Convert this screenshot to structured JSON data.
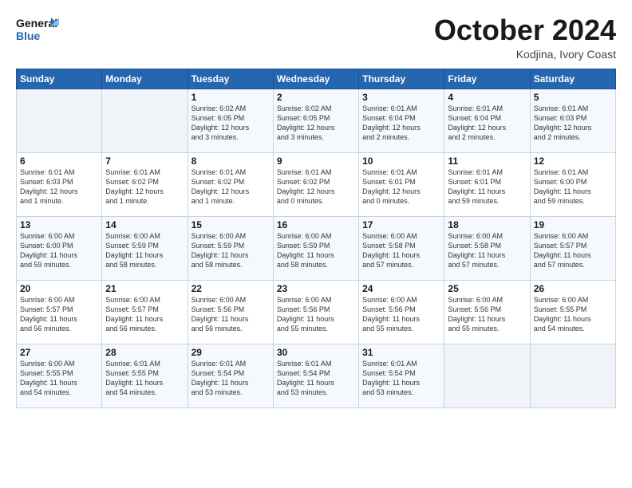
{
  "header": {
    "logo_line1": "General",
    "logo_line2": "Blue",
    "month_title": "October 2024",
    "subtitle": "Kodjina, Ivory Coast"
  },
  "weekdays": [
    "Sunday",
    "Monday",
    "Tuesday",
    "Wednesday",
    "Thursday",
    "Friday",
    "Saturday"
  ],
  "weeks": [
    [
      {
        "day": "",
        "info": ""
      },
      {
        "day": "",
        "info": ""
      },
      {
        "day": "1",
        "info": "Sunrise: 6:02 AM\nSunset: 6:05 PM\nDaylight: 12 hours\nand 3 minutes."
      },
      {
        "day": "2",
        "info": "Sunrise: 6:02 AM\nSunset: 6:05 PM\nDaylight: 12 hours\nand 3 minutes."
      },
      {
        "day": "3",
        "info": "Sunrise: 6:01 AM\nSunset: 6:04 PM\nDaylight: 12 hours\nand 2 minutes."
      },
      {
        "day": "4",
        "info": "Sunrise: 6:01 AM\nSunset: 6:04 PM\nDaylight: 12 hours\nand 2 minutes."
      },
      {
        "day": "5",
        "info": "Sunrise: 6:01 AM\nSunset: 6:03 PM\nDaylight: 12 hours\nand 2 minutes."
      }
    ],
    [
      {
        "day": "6",
        "info": "Sunrise: 6:01 AM\nSunset: 6:03 PM\nDaylight: 12 hours\nand 1 minute."
      },
      {
        "day": "7",
        "info": "Sunrise: 6:01 AM\nSunset: 6:02 PM\nDaylight: 12 hours\nand 1 minute."
      },
      {
        "day": "8",
        "info": "Sunrise: 6:01 AM\nSunset: 6:02 PM\nDaylight: 12 hours\nand 1 minute."
      },
      {
        "day": "9",
        "info": "Sunrise: 6:01 AM\nSunset: 6:02 PM\nDaylight: 12 hours\nand 0 minutes."
      },
      {
        "day": "10",
        "info": "Sunrise: 6:01 AM\nSunset: 6:01 PM\nDaylight: 12 hours\nand 0 minutes."
      },
      {
        "day": "11",
        "info": "Sunrise: 6:01 AM\nSunset: 6:01 PM\nDaylight: 11 hours\nand 59 minutes."
      },
      {
        "day": "12",
        "info": "Sunrise: 6:01 AM\nSunset: 6:00 PM\nDaylight: 11 hours\nand 59 minutes."
      }
    ],
    [
      {
        "day": "13",
        "info": "Sunrise: 6:00 AM\nSunset: 6:00 PM\nDaylight: 11 hours\nand 59 minutes."
      },
      {
        "day": "14",
        "info": "Sunrise: 6:00 AM\nSunset: 5:59 PM\nDaylight: 11 hours\nand 58 minutes."
      },
      {
        "day": "15",
        "info": "Sunrise: 6:00 AM\nSunset: 5:59 PM\nDaylight: 11 hours\nand 58 minutes."
      },
      {
        "day": "16",
        "info": "Sunrise: 6:00 AM\nSunset: 5:59 PM\nDaylight: 11 hours\nand 58 minutes."
      },
      {
        "day": "17",
        "info": "Sunrise: 6:00 AM\nSunset: 5:58 PM\nDaylight: 11 hours\nand 57 minutes."
      },
      {
        "day": "18",
        "info": "Sunrise: 6:00 AM\nSunset: 5:58 PM\nDaylight: 11 hours\nand 57 minutes."
      },
      {
        "day": "19",
        "info": "Sunrise: 6:00 AM\nSunset: 5:57 PM\nDaylight: 11 hours\nand 57 minutes."
      }
    ],
    [
      {
        "day": "20",
        "info": "Sunrise: 6:00 AM\nSunset: 5:57 PM\nDaylight: 11 hours\nand 56 minutes."
      },
      {
        "day": "21",
        "info": "Sunrise: 6:00 AM\nSunset: 5:57 PM\nDaylight: 11 hours\nand 56 minutes."
      },
      {
        "day": "22",
        "info": "Sunrise: 6:00 AM\nSunset: 5:56 PM\nDaylight: 11 hours\nand 56 minutes."
      },
      {
        "day": "23",
        "info": "Sunrise: 6:00 AM\nSunset: 5:56 PM\nDaylight: 11 hours\nand 55 minutes."
      },
      {
        "day": "24",
        "info": "Sunrise: 6:00 AM\nSunset: 5:56 PM\nDaylight: 11 hours\nand 55 minutes."
      },
      {
        "day": "25",
        "info": "Sunrise: 6:00 AM\nSunset: 5:56 PM\nDaylight: 11 hours\nand 55 minutes."
      },
      {
        "day": "26",
        "info": "Sunrise: 6:00 AM\nSunset: 5:55 PM\nDaylight: 11 hours\nand 54 minutes."
      }
    ],
    [
      {
        "day": "27",
        "info": "Sunrise: 6:00 AM\nSunset: 5:55 PM\nDaylight: 11 hours\nand 54 minutes."
      },
      {
        "day": "28",
        "info": "Sunrise: 6:01 AM\nSunset: 5:55 PM\nDaylight: 11 hours\nand 54 minutes."
      },
      {
        "day": "29",
        "info": "Sunrise: 6:01 AM\nSunset: 5:54 PM\nDaylight: 11 hours\nand 53 minutes."
      },
      {
        "day": "30",
        "info": "Sunrise: 6:01 AM\nSunset: 5:54 PM\nDaylight: 11 hours\nand 53 minutes."
      },
      {
        "day": "31",
        "info": "Sunrise: 6:01 AM\nSunset: 5:54 PM\nDaylight: 11 hours\nand 53 minutes."
      },
      {
        "day": "",
        "info": ""
      },
      {
        "day": "",
        "info": ""
      }
    ]
  ]
}
